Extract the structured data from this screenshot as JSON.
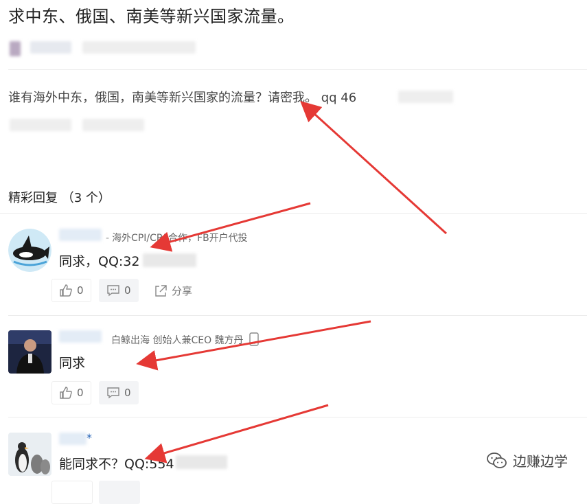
{
  "question": {
    "title": "求中东、俄国、南美等新兴国家流量。",
    "body": "谁有海外中东，俄国，南美等新兴国家的流量？请密我。 qq 46"
  },
  "replies": {
    "header": "精彩回复 （3 个）",
    "items": [
      {
        "author_tag": "海外CPI/CPA合作，FB开户代投",
        "comment": "同求，QQ:32",
        "likes": "0",
        "comments": "0",
        "share_label": "分享"
      },
      {
        "author_tag": "白鲸出海 创始人兼CEO 魏方丹",
        "comment": "同求",
        "likes": "0",
        "comments": "0"
      },
      {
        "author_star": "*",
        "comment": "能同求不？QQ:554"
      }
    ]
  },
  "watermark": {
    "text": "边赚边学"
  },
  "colors": {
    "arrow": "#e53935",
    "link_blue": "#1f5fb5"
  }
}
